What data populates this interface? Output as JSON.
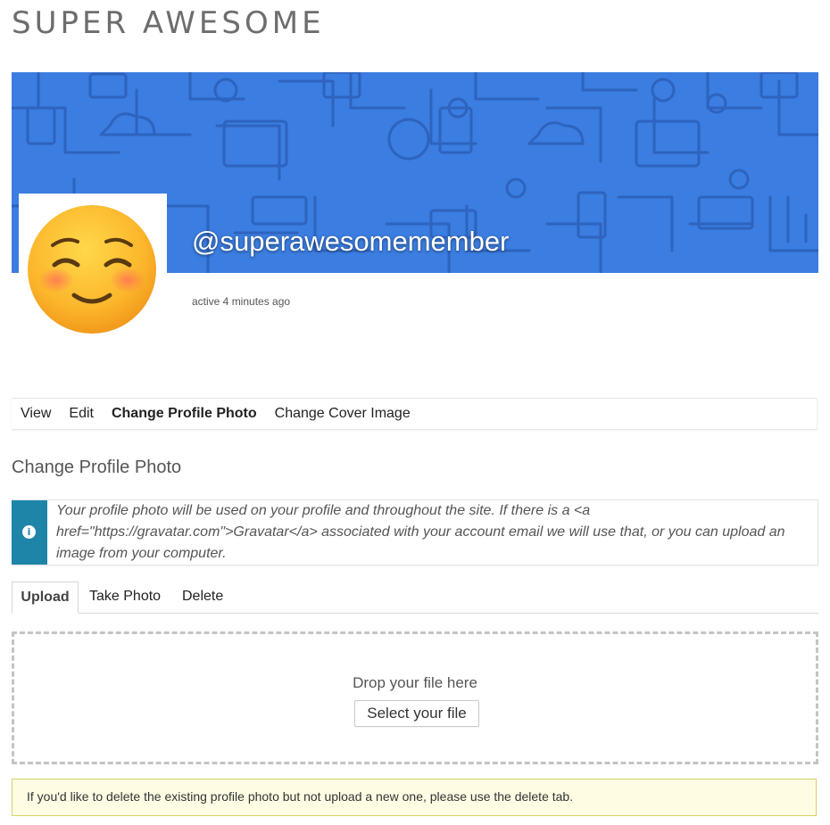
{
  "site": {
    "title": "SUPER AWESOME"
  },
  "profile": {
    "username": "@superawesomemember",
    "activity": "active 4 minutes ago"
  },
  "nav": {
    "items": [
      {
        "label": "View"
      },
      {
        "label": "Edit"
      },
      {
        "label": "Change Profile Photo",
        "current": true
      },
      {
        "label": "Change Cover Image"
      }
    ]
  },
  "page": {
    "title": "Change Profile Photo",
    "notice_icon": "info-icon",
    "notice": "Your profile photo will be used on your profile and throughout the site. If there is a <a href=\"https://gravatar.com\">Gravatar</a> associated with your account email we will use that, or you can upload an image from your computer."
  },
  "tabs": {
    "items": [
      {
        "label": "Upload",
        "active": true
      },
      {
        "label": "Take Photo"
      },
      {
        "label": "Delete"
      }
    ]
  },
  "upload": {
    "drop_text": "Drop your file here",
    "select_label": "Select your file"
  },
  "warning": {
    "text": "If you'd like to delete the existing profile photo but not upload a new one, please use the delete tab."
  },
  "colors": {
    "cover": "#3b7de0",
    "notice_bar": "#1e85a8",
    "warning_bg": "#fefde4",
    "warning_border": "#d6cf6c"
  }
}
